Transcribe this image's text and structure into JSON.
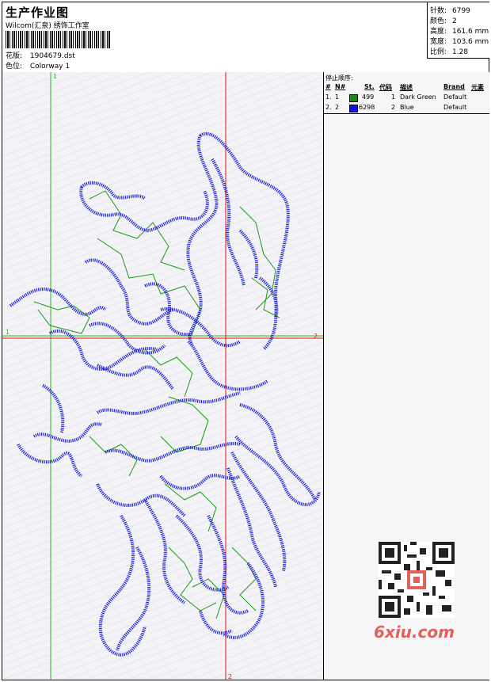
{
  "header": {
    "title": "生产作业图",
    "studio": "Wilcom(汇泉) 绣饰工作室",
    "design_label": "花版:",
    "design_value": "1904679.dst",
    "colorway_label": "色位:",
    "colorway_value": "Colorway 1"
  },
  "stats": [
    {
      "label": "针数:",
      "value": "6799"
    },
    {
      "label": "颜色:",
      "value": "2"
    },
    {
      "label": "高度:",
      "value": "161.6 mm"
    },
    {
      "label": "宽度:",
      "value": "103.6 mm"
    },
    {
      "label": "比例:",
      "value": "1.28"
    }
  ],
  "stop_sequence": {
    "title": "停止顺序:",
    "columns": [
      "#",
      "N#",
      "St.",
      "代码",
      "描述",
      "Brand",
      "元素"
    ],
    "rows": [
      {
        "idx": "1.",
        "n": "1",
        "stitches": "499",
        "code": "1",
        "desc": "Dark Green",
        "brand": "Default",
        "color": "#1a8a1a"
      },
      {
        "idx": "2.",
        "n": "2",
        "stitches": "6298",
        "code": "2",
        "desc": "Blue",
        "brand": "Default",
        "color": "#1010e0"
      }
    ]
  },
  "guides": {
    "vertical_green_label": "1",
    "horizontal_green_label": "1",
    "horizontal_red_label": "2",
    "vertical_red_label": "2"
  },
  "colors": {
    "satin": "#1c22d8",
    "run": "#1a9a1a",
    "guide_red": "#e01010",
    "guide_green": "#20c020"
  },
  "watermark": {
    "text": "6xiu.com"
  }
}
